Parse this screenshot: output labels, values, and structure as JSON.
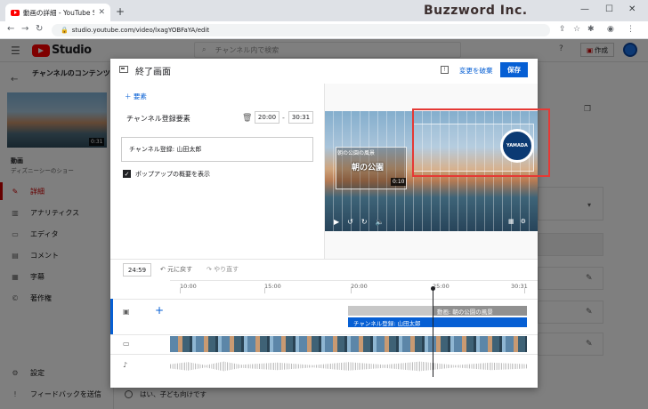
{
  "browser": {
    "tab_title": "動画の詳細 - YouTube Studio",
    "url": "studio.youtube.com/video/lxagYOBFaYA/edit",
    "brand_watermark": "Buzzword Inc."
  },
  "studio": {
    "logo_text": "Studio",
    "search_placeholder": "チャンネル内で検索",
    "create_label": "作成"
  },
  "sidebar": {
    "channel_title": "チャンネルのコンテンツ",
    "thumb_duration": "0:31",
    "video_label": "動画",
    "video_name": "ディズニーシーのショー",
    "items": [
      {
        "label": "詳細",
        "icon": "pencil-icon"
      },
      {
        "label": "アナリティクス",
        "icon": "analytics-icon"
      },
      {
        "label": "エディタ",
        "icon": "editor-icon"
      },
      {
        "label": "コメント",
        "icon": "comment-icon"
      },
      {
        "label": "字幕",
        "icon": "subtitles-icon"
      },
      {
        "label": "著作権",
        "icon": "copyright-icon"
      }
    ],
    "bottom_items": [
      {
        "label": "設定",
        "icon": "gear-icon"
      },
      {
        "label": "フィードバックを送信",
        "icon": "feedback-icon"
      }
    ]
  },
  "background": {
    "radio_label": "はい、子ども向けです"
  },
  "modal": {
    "title": "終了画面",
    "discard_label": "変更を破棄",
    "save_label": "保存",
    "add_element_label": "要素",
    "element_label": "チャンネル登録要素",
    "start_time": "20:00",
    "end_time": "30:31",
    "channel_select": "チャンネル登録: 山田太郎",
    "popup_checkbox_label": "ポップアップの概要を表示",
    "preview": {
      "video_card_title": "朝の公園の風景",
      "video_card_text": "朝の公園",
      "video_card_duration": "0:10",
      "channel_logo_text": "YAMADA"
    },
    "timeline": {
      "current_time": "24:59",
      "undo_label": "元に戻す",
      "redo_label": "やり直す",
      "ticks": [
        "10:00",
        "15:00",
        "20:00",
        "25:00",
        "30:31"
      ],
      "video_element_label": "動画: 朝の公園の風景",
      "subscribe_element_label": "チャンネル登録: 山田太郎"
    }
  }
}
